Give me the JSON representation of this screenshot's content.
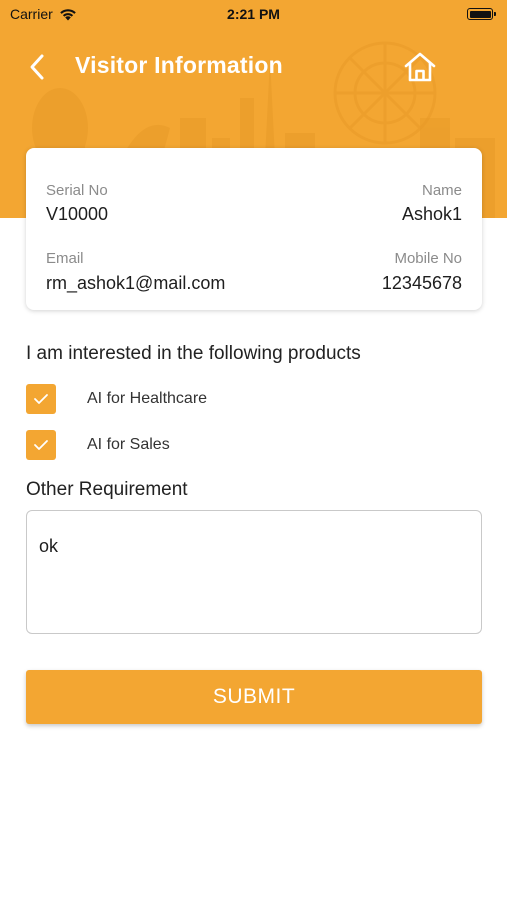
{
  "status_bar": {
    "carrier": "Carrier",
    "time": "2:21 PM"
  },
  "header": {
    "title": "Visitor Information",
    "back_icon": "chevron-left-icon",
    "home_icon": "home-icon"
  },
  "visitor": {
    "serial_label": "Serial No",
    "serial_value": "V10000",
    "name_label": "Name",
    "name_value": "Ashok1",
    "email_label": "Email",
    "email_value": "rm_ashok1@mail.com",
    "mobile_label": "Mobile No",
    "mobile_value": "12345678"
  },
  "products": {
    "title": "I am interested in the following products",
    "items": [
      {
        "label": "AI for Healthcare",
        "checked": true
      },
      {
        "label": "AI for Sales",
        "checked": true
      }
    ]
  },
  "other_requirement": {
    "title": "Other Requirement",
    "value": "ok"
  },
  "submit_label": "SUBMIT",
  "colors": {
    "accent": "#f3a632",
    "white": "#ffffff"
  }
}
